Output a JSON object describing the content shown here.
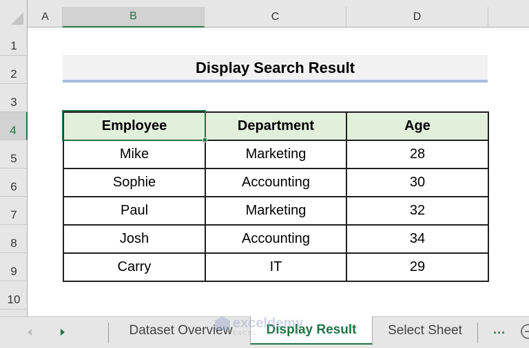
{
  "columns": [
    "A",
    "B",
    "C",
    "D"
  ],
  "selected_column": "B",
  "rows": [
    "1",
    "2",
    "3",
    "4",
    "5",
    "6",
    "7",
    "8",
    "9",
    "10"
  ],
  "selected_row": "4",
  "title": "Display Search Result",
  "table": {
    "headers": [
      "Employee",
      "Department",
      "Age"
    ],
    "rows": [
      [
        "Mike",
        "Marketing",
        "28"
      ],
      [
        "Sophie",
        "Accounting",
        "30"
      ],
      [
        "Paul",
        "Marketing",
        "32"
      ],
      [
        "Josh",
        "Accounting",
        "34"
      ],
      [
        "Carry",
        "IT",
        "29"
      ]
    ]
  },
  "sheet_tabs": [
    {
      "label": "Dataset Overview",
      "active": false
    },
    {
      "label": "Display Result",
      "active": true
    },
    {
      "label": "Select Sheet",
      "active": false
    }
  ],
  "more_tabs_label": "...",
  "watermark": {
    "text": "exceldemy",
    "sub": "EXCEL · DATA · BI"
  },
  "colors": {
    "accent": "#217346",
    "header_fill": "#e2efda",
    "title_fill": "#f2f2f2",
    "title_underline": "#a6bcdf"
  }
}
